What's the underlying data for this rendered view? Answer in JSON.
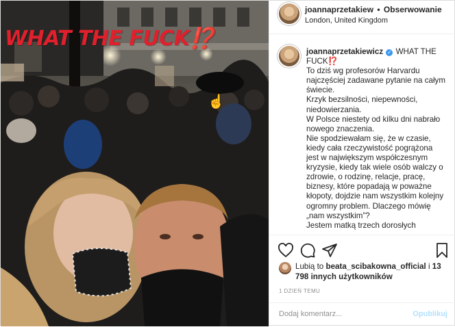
{
  "photo": {
    "overlay_text": "WHAT THE FUCK⁉️"
  },
  "header": {
    "username": "joannaprzetakiew",
    "separator": "•",
    "follow_label": "Obserwowanie",
    "location": "London, United Kingdom"
  },
  "caption": {
    "username": "joannaprzetakiewicz",
    "verified_mark": "✓",
    "lines": [
      "WHAT THE FUCK⁉️",
      "To dziś wg profesorów Harvardu najczęściej zadawane pytanie na całym świecie.",
      "Krzyk bezsilności, niepewności, niedowierzania.",
      "W Polsce niestety od kilku dni nabrało nowego znaczenia.",
      "Nie spodziewałam się, że w czasie, kiedy cała rzeczywistość pogrążona jest w największym współczesnym kryzysie, kiedy tak wiele osób walczy o zdrowie, o rodzinę, relacje, pracę, biznesy, które popadają w poważne kłopoty, dojdzie nam wszystkim kolejny ogromny problem. Dlaczego mówię „nam wszystkim”?",
      "Jestem matką trzech dorosłych"
    ]
  },
  "actions": {
    "like_icon": "heart-icon",
    "comment_icon": "comment-icon",
    "share_icon": "share-icon",
    "save_icon": "bookmark-icon"
  },
  "likes": {
    "prefix": "Lubią to ",
    "liker": "beata_scibakowna_official",
    "middle": " i ",
    "count_text": "13 798 innych użytkowników"
  },
  "timestamp": "1 DZIEŃ TEMU",
  "comment": {
    "placeholder": "Dodaj komentarz...",
    "post_label": "Opublikuj"
  }
}
